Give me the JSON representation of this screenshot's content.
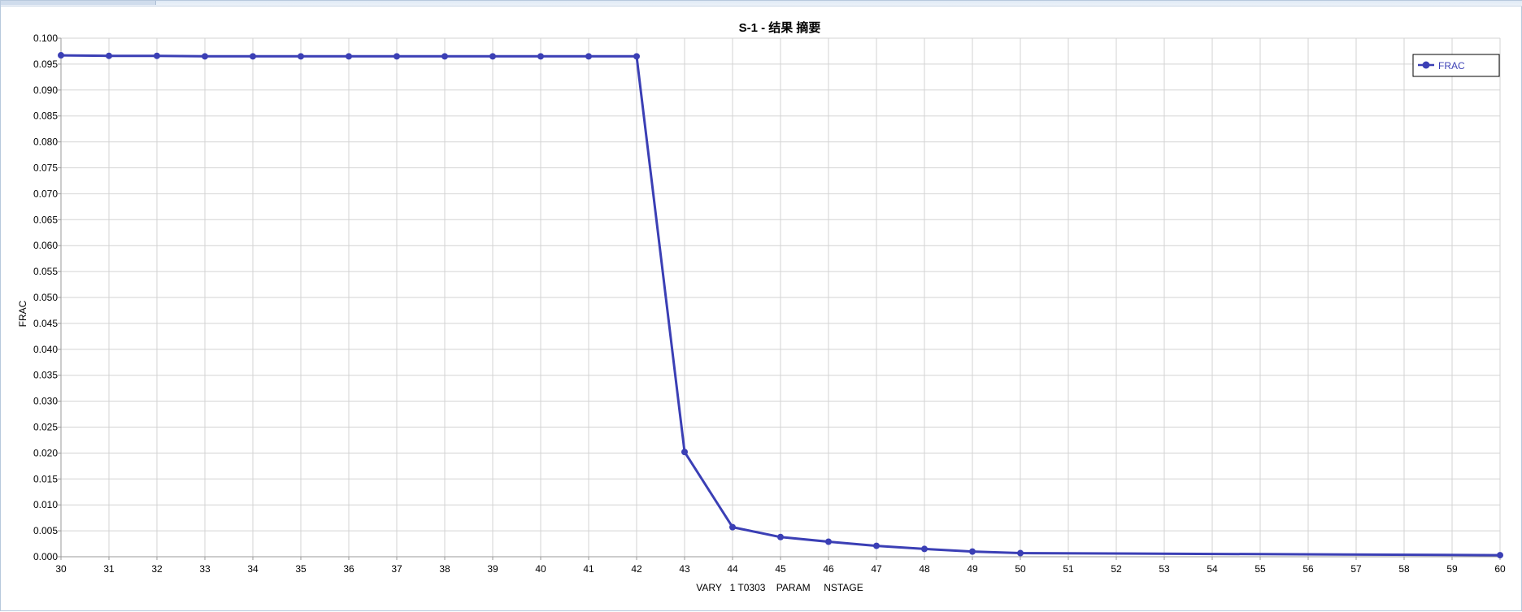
{
  "chart_data": {
    "type": "line",
    "title": "S-1 - 结果 摘要",
    "xlabel": "VARY   1 T0303    PARAM     NSTAGE",
    "ylabel": "FRAC",
    "xlim": [
      30,
      60
    ],
    "ylim": [
      0,
      0.1
    ],
    "x_ticks": [
      "30",
      "31",
      "32",
      "33",
      "34",
      "35",
      "36",
      "37",
      "38",
      "39",
      "40",
      "41",
      "42",
      "43",
      "44",
      "45",
      "46",
      "47",
      "48",
      "49",
      "50",
      "51",
      "52",
      "53",
      "54",
      "55",
      "56",
      "57",
      "58",
      "59",
      "60"
    ],
    "y_ticks": [
      "0.000",
      "0.005",
      "0.010",
      "0.015",
      "0.020",
      "0.025",
      "0.030",
      "0.035",
      "0.040",
      "0.045",
      "0.050",
      "0.055",
      "0.060",
      "0.065",
      "0.070",
      "0.075",
      "0.080",
      "0.085",
      "0.090",
      "0.095",
      "0.100"
    ],
    "grid": true,
    "legend_position": "top-right",
    "series": [
      {
        "name": "FRAC",
        "color": "#3b3fb5",
        "x": [
          30,
          31,
          32,
          33,
          34,
          35,
          36,
          37,
          38,
          39,
          40,
          41,
          42,
          43,
          44,
          45,
          46,
          47,
          48,
          49,
          50,
          60
        ],
        "y": [
          0.0967,
          0.0966,
          0.0966,
          0.0965,
          0.0965,
          0.0965,
          0.0965,
          0.0965,
          0.0965,
          0.0965,
          0.0965,
          0.0965,
          0.0965,
          0.0202,
          0.0057,
          0.0038,
          0.0029,
          0.0021,
          0.0015,
          0.001,
          0.0007,
          0.0003
        ]
      }
    ]
  }
}
